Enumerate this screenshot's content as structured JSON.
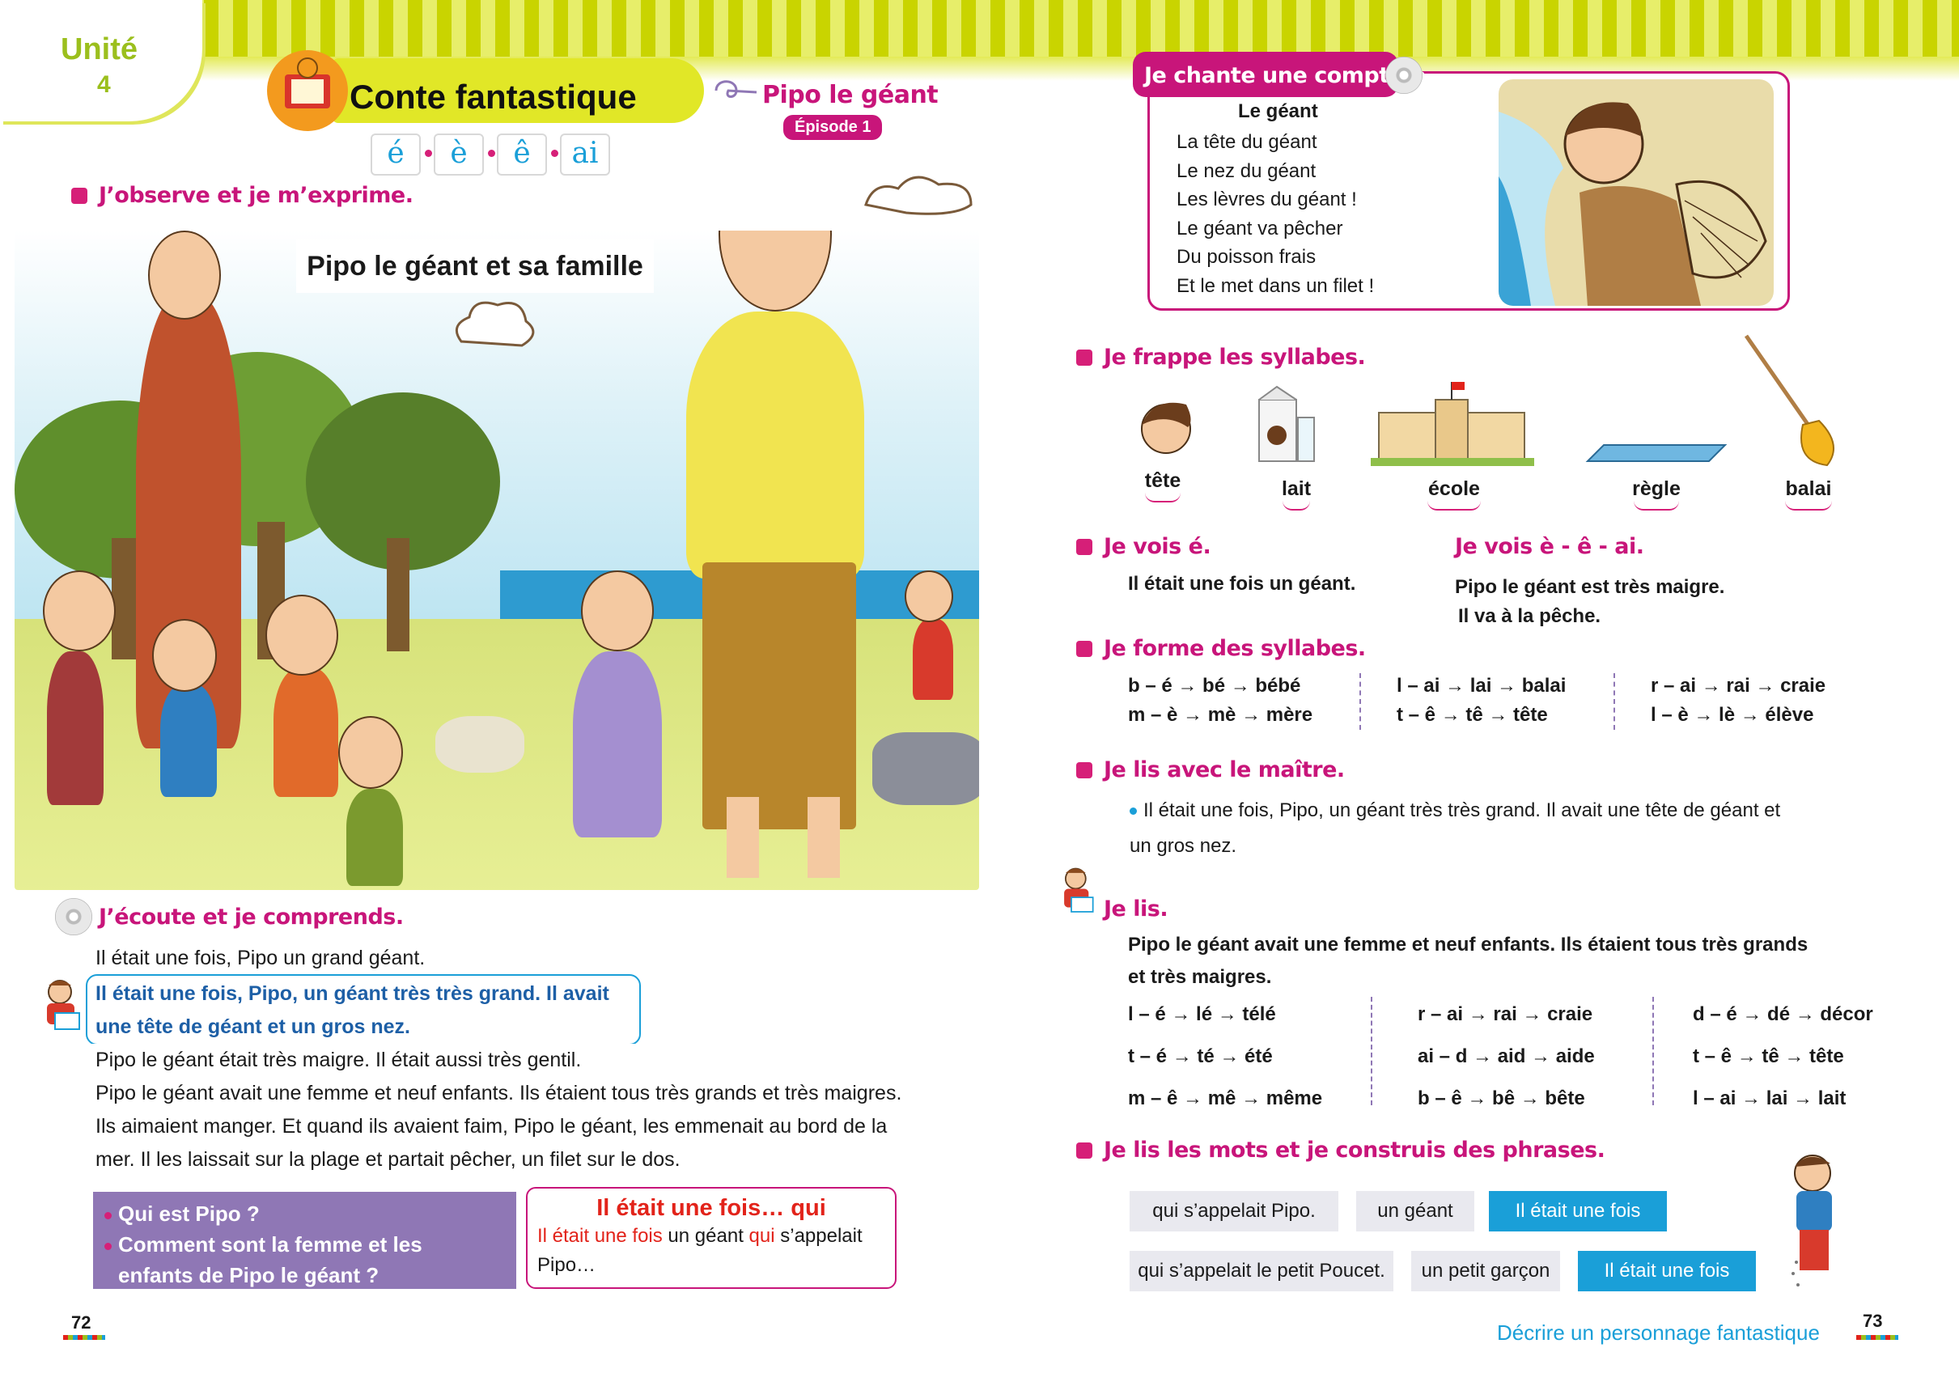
{
  "header": {
    "unit_label": "Unité",
    "unit_number": "4",
    "title": "Conte fantastique",
    "letters": [
      "é",
      "è",
      "ê",
      "ai"
    ],
    "story_title": "Pipo le géant",
    "episode": "Épisode 1"
  },
  "left": {
    "observe_title": "J’observe et je m’exprime.",
    "scene_caption": "Pipo le géant et sa famille",
    "listen_title": "J’écoute et je comprends.",
    "story_lines": [
      "Il était une fois, Pipo un grand géant.",
      "Pipo le géant était très maigre. Il était aussi très gentil.",
      "Pipo le géant avait une femme et neuf enfants. Ils étaient tous très grands et très maigres.",
      "Ils aimaient manger. Et quand ils avaient faim, Pipo le géant, les emmenait au bord de la",
      "mer. Il les laissait sur la plage et partait pêcher, un filet sur le dos."
    ],
    "highlight_lines": [
      "Il était une fois, Pipo, un géant très très grand. Il avait",
      "une tête de géant et un gros nez."
    ],
    "questions": [
      "Qui est Pipo ?",
      "Comment sont la femme et les",
      "enfants de Pipo le géant ?"
    ],
    "fois_box": {
      "title": "Il était une fois… qui",
      "line1_red": "Il était une fois",
      "line1_mid": " un géant ",
      "line1_red2": "qui",
      "line1_end": " s’appelait",
      "line2": "Pipo…"
    },
    "page_number": "72"
  },
  "right": {
    "comptine_title": "Je chante une comptine",
    "poem_title": "Le géant",
    "poem_lines": [
      "La tête du géant",
      "Le nez du géant",
      "Les lèvres du géant !",
      "Le géant va pêcher",
      "Du poisson frais",
      "Et le met dans un filet !"
    ],
    "syllables_title": "Je frappe les syllabes.",
    "syllable_words": [
      "tête",
      "lait",
      "école",
      "règle",
      "balai"
    ],
    "vois_e_title": "Je vois é.",
    "vois_e_text": "Il était une fois un géant.",
    "vois_other_title": "Je vois è - ê - ai.",
    "vois_other_lines": [
      "Pipo le géant est très maigre.",
      "Il va à la pêche."
    ],
    "forme_title": "Je forme des syllabes.",
    "forme_cols": [
      [
        "b – é → bé →  bébé",
        "m – è → mè → mère"
      ],
      [
        "l – ai → lai → balai",
        "t – ê → tê → tête"
      ],
      [
        "r – ai → rai → craie",
        "l – è → lè → élève"
      ]
    ],
    "maitre_title": "Je lis avec le maître.",
    "maitre_lines": [
      "Il était une fois, Pipo, un géant très très grand. Il avait une tête de géant et",
      "un gros nez."
    ],
    "lis_title": "Je lis.",
    "lis_lines": [
      "Pipo le géant avait une femme et neuf enfants. Ils étaient tous très grands",
      "et très maigres."
    ],
    "lis_cols": [
      [
        "l – é → lé → télé",
        "t – é → té → été",
        "m – ê → mê → même"
      ],
      [
        "r – ai → rai → craie",
        "ai – d → aid → aide",
        "b – ê → bê →  bête"
      ],
      [
        "d – é → dé → décor",
        "t – ê → tê → tête",
        "l – ai → lai → lait"
      ]
    ],
    "construis_title": "Je lis les mots et je construis des phrases.",
    "chips_row1": [
      "qui s’appelait Pipo.",
      "un géant",
      "Il était une fois"
    ],
    "chips_row2": [
      "qui s’appelait le petit Poucet.",
      "un petit garçon",
      "Il était une fois"
    ],
    "footer": "Décrire un personnage fantastique",
    "page_number": "73"
  },
  "colors": {
    "accent_magenta": "#c8157a",
    "accent_blue": "#1a9fd8",
    "accent_red": "#e2231a",
    "lime": "#e1e727",
    "purple": "#8f77b5"
  }
}
